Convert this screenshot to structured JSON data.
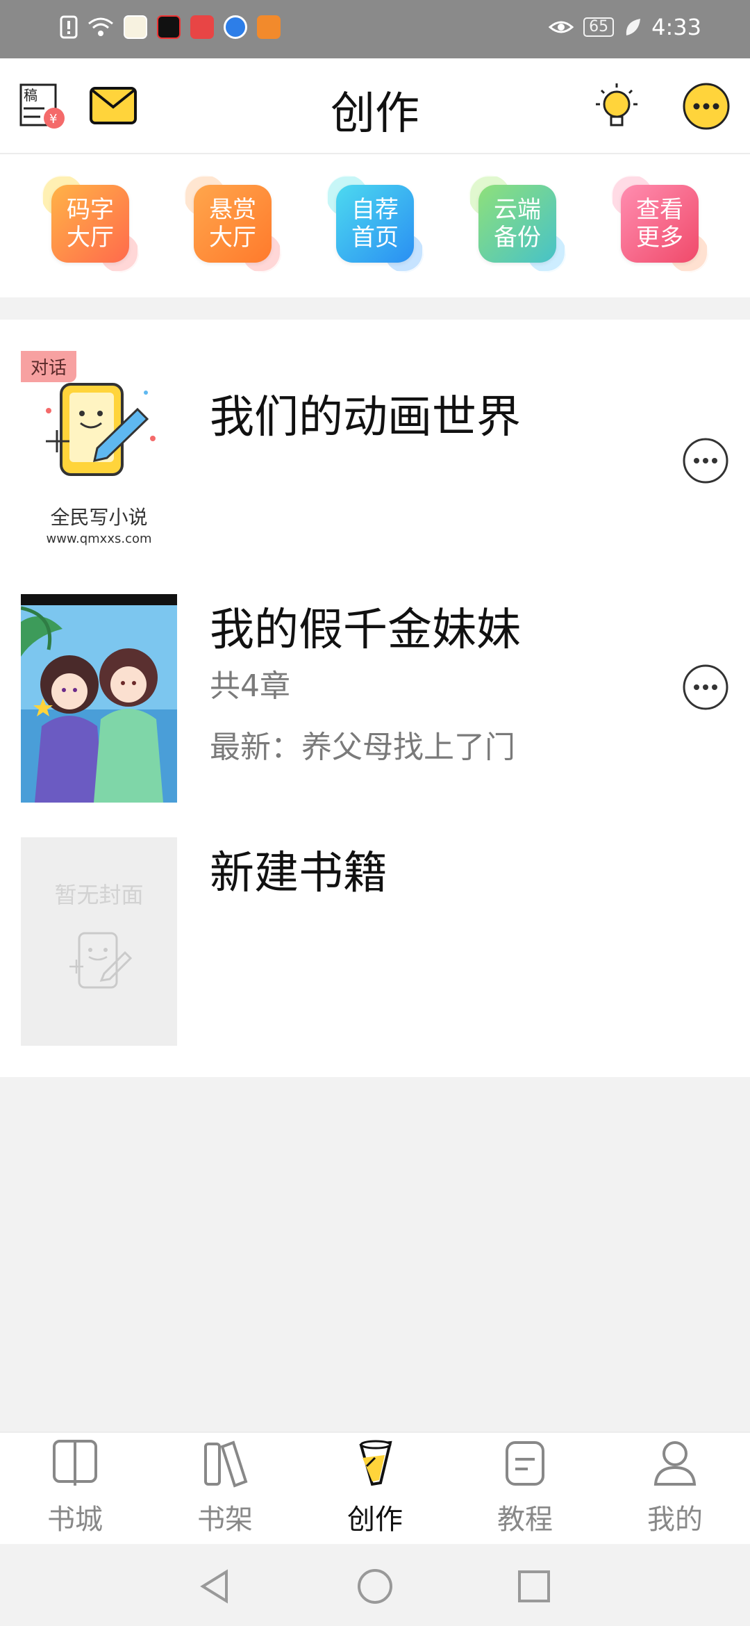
{
  "status_bar": {
    "time": "4:33",
    "battery": "65",
    "icons": [
      "alert-icon",
      "wifi-icon",
      "app-icon",
      "video-icon",
      "huawei-icon",
      "browser-icon",
      "play-icon",
      "eye-icon",
      "leaf-icon"
    ]
  },
  "header": {
    "title": "创作",
    "left_icons": [
      "draft-money-icon",
      "mail-icon"
    ],
    "right_icons": [
      "bulb-icon",
      "more-icon"
    ]
  },
  "quick_actions": [
    {
      "line1": "码字",
      "line2": "大厅",
      "color": "#ff8a4c"
    },
    {
      "line1": "悬赏",
      "line2": "大厅",
      "color": "#ff8d3a"
    },
    {
      "line1": "自荐",
      "line2": "首页",
      "color": "#3ab8f5"
    },
    {
      "line1": "云端",
      "line2": "备份",
      "color": "#66cfa7"
    },
    {
      "line1": "查看",
      "line2": "更多",
      "color": "#f56b8a"
    }
  ],
  "books": [
    {
      "title": "我们的动画世界",
      "tag": "对话",
      "cover_text": "全民写小说",
      "cover_url_text": "www.qmxxs.com"
    },
    {
      "title": "我的假千金妹妹",
      "chapters": "共4章",
      "latest": "最新：养父母找上了门"
    },
    {
      "title": "新建书籍",
      "placeholder": "暂无封面"
    }
  ],
  "bottom_nav": [
    {
      "label": "书城",
      "icon": "book-open-icon",
      "active": false
    },
    {
      "label": "书架",
      "icon": "bookshelf-icon",
      "active": false
    },
    {
      "label": "创作",
      "icon": "create-pen-icon",
      "active": true
    },
    {
      "label": "教程",
      "icon": "tutorial-icon",
      "active": false
    },
    {
      "label": "我的",
      "icon": "user-icon",
      "active": false
    }
  ],
  "system_nav": [
    "back-icon",
    "home-icon",
    "recents-icon"
  ]
}
